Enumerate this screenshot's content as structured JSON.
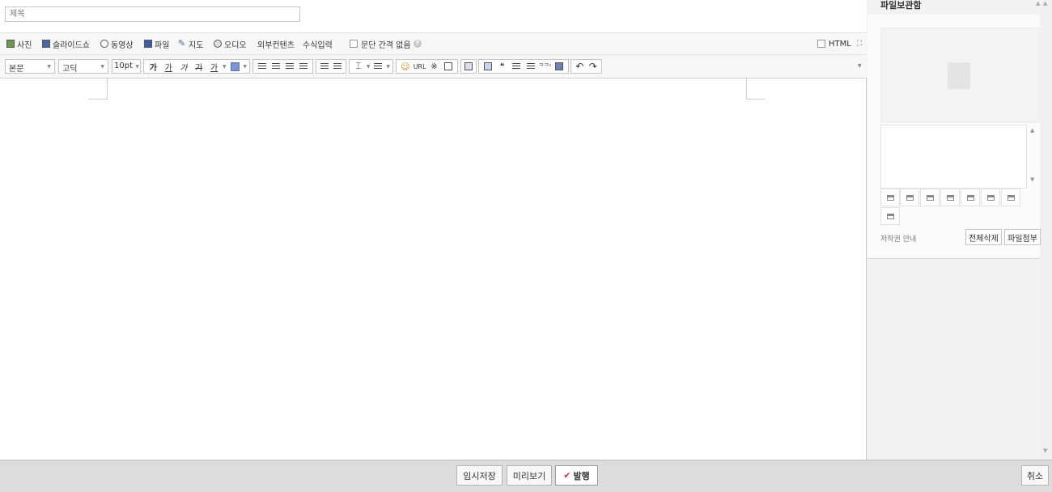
{
  "title_input": {
    "placeholder": "제목"
  },
  "insert_toolbar": {
    "photo": "사진",
    "slideshow": "슬라이드쇼",
    "video": "동영상",
    "file": "파일",
    "map": "지도",
    "audio": "오디오",
    "external_content": "외부컨텐츠",
    "formula": "수식입력",
    "no_paragraph_spacing": "문단 간격 없음",
    "html_toggle": "HTML"
  },
  "format_toolbar": {
    "paragraph_style": "본문",
    "font_family": "고딕",
    "font_size": "10pt",
    "bold": "가",
    "underline": "가",
    "italic": "가",
    "strike": "가",
    "text_color": "가",
    "url": "URL",
    "special_char": "※",
    "quote": "❝",
    "superscript": "ᄏᄏ¹"
  },
  "sidebar": {
    "title": "파일보관함",
    "copyright_link": "저작권 안내",
    "delete_all": "전체삭제",
    "attach_file": "파일첨부"
  },
  "footer": {
    "save_draft": "임시저장",
    "preview": "미리보기",
    "publish": "발행",
    "cancel": "취소"
  },
  "colors": {
    "toolbar_bg": "#f7f7f7",
    "footer_bg": "#dcdcdc",
    "publish_check": "#d0343a",
    "highlight_blue": "#7b94d6"
  }
}
